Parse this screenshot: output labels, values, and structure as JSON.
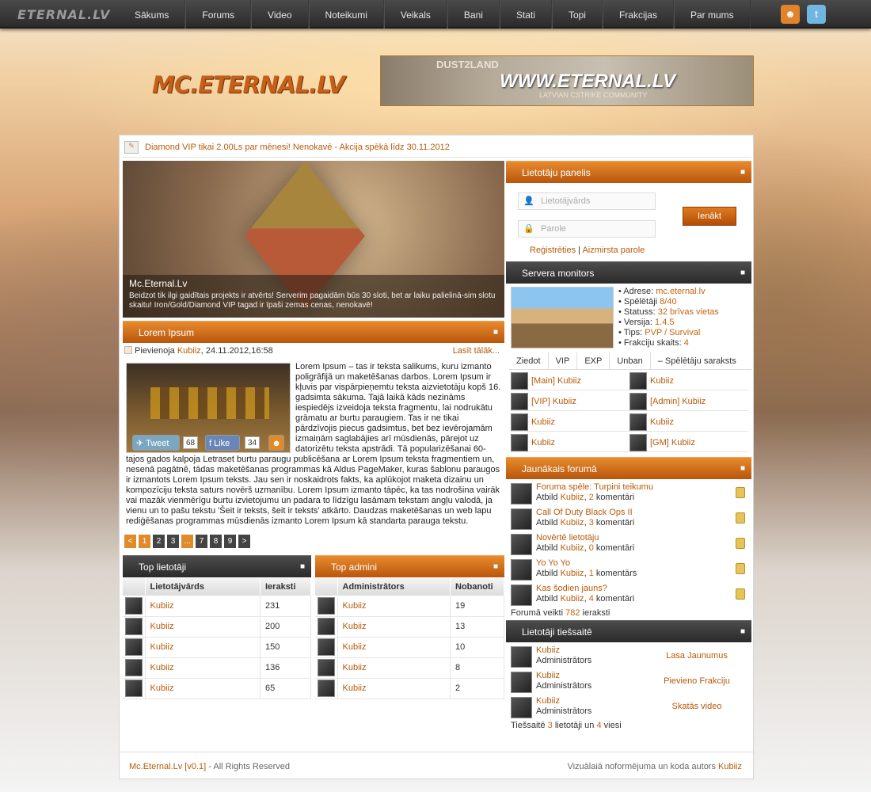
{
  "topbar": {
    "logo": "ETERNAL.LV",
    "nav": [
      "Sākums",
      "Forums",
      "Video",
      "Noteikumi",
      "Veikals",
      "Bani",
      "Stati",
      "Topi",
      "Frakcijas",
      "Par mums"
    ]
  },
  "header": {
    "logo": "MC.ETERNAL.LV",
    "banner_top": "DUST2LAND",
    "banner_main": "WWW.ETERNAL.LV",
    "banner_sub": "LATVIAN CSTRIKE COMMUNITY"
  },
  "promo": {
    "text": "Diamond VIP tikai 2.00Ls par mēnesi! Nenokavē - Akcija spēkā līdz 30.11.2012"
  },
  "slide": {
    "title": "Mc.Eternal.Lv",
    "desc": "Beidzot tik ilgi gaidītais projekts ir atvērts! Serverim pagaidām būs 30 sloti, bet ar laiku palielinā-sim slotu skaitu! Iron/Gold/Diamond VIP tagad ir īpaši zemas cenas, nenokavē!"
  },
  "article": {
    "title": "Lorem Ipsum",
    "added_by": "Pievienoja",
    "author": "Kubiiz",
    "date": ", 24.11.2012,16:58",
    "more": "Lasīt tālāk...",
    "tweet": "Tweet",
    "tweet_count": "68",
    "like": "Like",
    "like_count": "34",
    "body": "Lorem Ipsum – tas ir teksta salikums, kuru izmanto poligrāfijā un maketēšanas darbos. Lorem Ipsum ir kļuvis par vispārpieņemtu teksta aizvietotāju kopš 16. gadsimta sākuma. Tajā laikā kāds nezināms iespiedējs izveidoja teksta fragmentu, lai nodrukātu grāmatu ar burtu paraugiem. Tas ir ne tikai pārdzīvojis piecus gadsimtus, bet bez ievērojamām izmaiņām saglabājies arī mūsdienās, pārejot uz datorizētu teksta apstrādi. Tā popularizēšanai 60-tajos gados kalpoja Letraset burtu paraugu publicēšana ar Lorem Ipsum teksta fragmentiem un, nesenā pagātnē, tādas maketēšanas programmas kā Aldus PageMaker, kuras šablonu paraugos ir izmantots Lorem Ipsum teksts. Jau sen ir noskaidrots fakts, ka aplūkojot maketa dizainu un kompozīciju teksta saturs novērš uzmanību. Lorem Ipsum izmanto tāpēc, ka tas nodrošina vairāk vai mazāk vienmērīgu burtu izvietojumu un padara to līdzīgu lasāmam tekstam angļu valodā, ja vienu un to pašu tekstu 'Šeit ir teksts, šeit ir teksts' atkārto. Daudzas maketēšanas un web lapu rediģēšanas programmas mūsdienās izmanto Lorem Ipsum kā standarta parauga tekstu."
  },
  "pager": [
    "<",
    "1",
    "2",
    "3",
    "...",
    "7",
    "8",
    "9",
    ">"
  ],
  "top_users": {
    "title": "Top lietotāji",
    "col1": "Lietotājvārds",
    "col2": "Ieraksti",
    "rows": [
      [
        "Kubiiz",
        "231"
      ],
      [
        "Kubiiz",
        "200"
      ],
      [
        "Kubiiz",
        "150"
      ],
      [
        "Kubiiz",
        "136"
      ],
      [
        "Kubiiz",
        "65"
      ]
    ]
  },
  "top_admins": {
    "title": "Top admini",
    "col1": "Administrātors",
    "col2": "Nobanoti",
    "rows": [
      [
        "Kubiiz",
        "19"
      ],
      [
        "Kubiiz",
        "13"
      ],
      [
        "Kubiiz",
        "10"
      ],
      [
        "Kubiiz",
        "8"
      ],
      [
        "Kubiiz",
        "2"
      ]
    ]
  },
  "login": {
    "title": "Lietotāju panelis",
    "user_ph": "Lietotājvārds",
    "pass_ph": "Parole",
    "button": "Ienākt",
    "register": "Reģistrēties",
    "sep": "|",
    "forgot": "Aizmirsta parole"
  },
  "server": {
    "title": "Servera monitors",
    "lines": [
      [
        "• Adrese: ",
        "mc.eternal.lv"
      ],
      [
        "• Spēlētāji ",
        "8/40"
      ],
      [
        "• Statuss: ",
        "32 brīvas vietas"
      ],
      [
        "• Versija: ",
        "1.4.5"
      ],
      [
        "• Tips: ",
        "PVP / Survival"
      ],
      [
        "• Frakciju skaits: ",
        "4"
      ]
    ],
    "tabs": [
      "Ziedot",
      "VIP",
      "EXP",
      "Unban",
      "‒ Spēlētāju saraksts"
    ],
    "players": [
      "[Main] Kubiiz",
      "Kubiiz",
      "[VIP] Kubiiz",
      "[Admin] Kubiiz",
      "Kubiiz",
      "Kubiiz",
      "Kubiiz",
      "[GM] Kubiiz"
    ]
  },
  "forum": {
    "title": "Jaunākais forumā",
    "reply": "Atbild",
    "items": [
      [
        "Foruma spēle: Turpini teikumu",
        "Kubiiz",
        "2",
        "komentāri"
      ],
      [
        "Call Of Duty Black Ops II",
        "Kubiiz",
        "3",
        "komentāri"
      ],
      [
        "Novērtē lietotāju",
        "Kubiiz",
        "0",
        "komentāri"
      ],
      [
        "Yo Yo Yo",
        "Kubiiz",
        "1",
        "komentārs"
      ],
      [
        "Kas šodien jauns?",
        "Kubiiz",
        "4",
        "komentāri"
      ]
    ],
    "total_pre": "Forumā veikti",
    "total": "782",
    "total_post": "ieraksti"
  },
  "online": {
    "title": "Lietotāji tiešsaitē",
    "role": "Administrātors",
    "items": [
      [
        "Kubiiz",
        "Lasa Jaunumus"
      ],
      [
        "Kubiiz",
        "Pievieno Frakciju"
      ],
      [
        "Kubiiz",
        "Skatās video"
      ]
    ],
    "sum_pre": "Tiešsaitē",
    "users": "3",
    "sum_mid": "lietotāji un",
    "guests": "4",
    "sum_post": "viesi"
  },
  "footer": {
    "left_link": "Mc.Eternal.Lv [v0.1]",
    "left_text": " - All Rights Reserved",
    "right_text": "Vizuālaiā noformējuma un koda autors ",
    "right_link": "Kubiiz"
  }
}
